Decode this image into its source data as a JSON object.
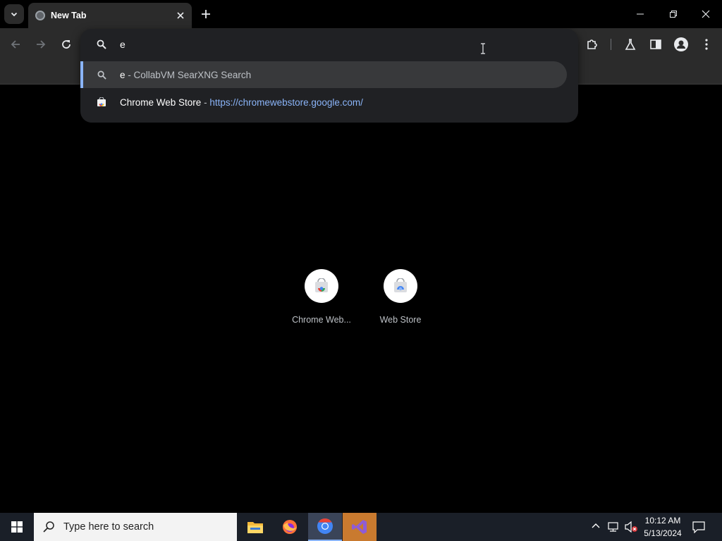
{
  "browser": {
    "tab": {
      "title": "New Tab"
    },
    "omnibox": {
      "input_value": "e",
      "suggestions": [
        {
          "query": "e",
          "separator": " - ",
          "description": "CollabVM SearXNG Search"
        },
        {
          "title": "Chrome Web Store",
          "separator": " - ",
          "url": "https://chromewebstore.google.com/"
        }
      ]
    },
    "shortcuts": [
      {
        "label": "Chrome Web..."
      },
      {
        "label": "Web Store"
      }
    ]
  },
  "taskbar": {
    "search_placeholder": "Type here to search",
    "clock_time": "10:12 AM",
    "clock_date": "5/13/2024",
    "apps": [
      "file-explorer-icon",
      "firefox-icon",
      "chrome-icon",
      "visual-studio-icon"
    ]
  },
  "colors": {
    "accent": "#8ab4f8",
    "background": "#000000",
    "toolbar": "#2b2b2b",
    "omnibox": "#202124"
  }
}
